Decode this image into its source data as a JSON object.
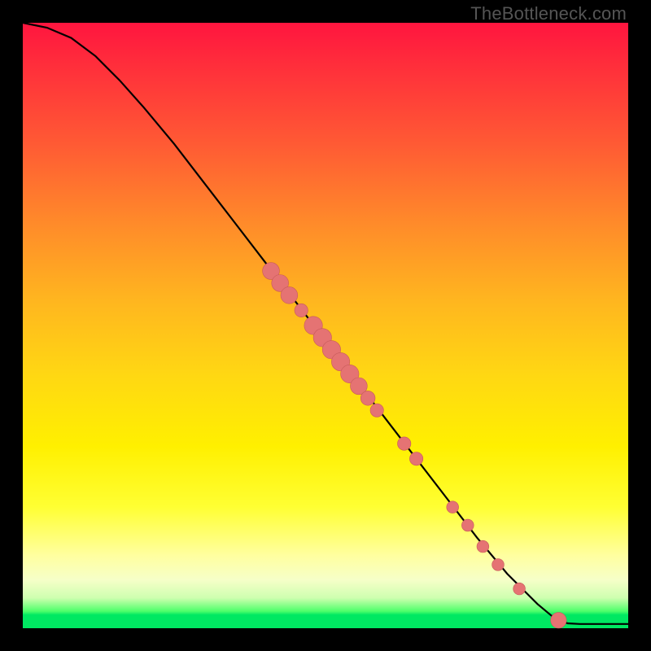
{
  "watermark": "TheBottleneck.com",
  "colors": {
    "bg": "#000000",
    "curve_stroke": "#000000",
    "marker_fill": "#e57373",
    "marker_stroke": "#c75a5a"
  },
  "chart_data": {
    "type": "line",
    "title": "",
    "xlabel": "",
    "ylabel": "",
    "xlim": [
      0,
      100
    ],
    "ylim": [
      0,
      100
    ],
    "grid": false,
    "legend": false,
    "curve": [
      {
        "x": 0,
        "y": 100
      },
      {
        "x": 4,
        "y": 99.2
      },
      {
        "x": 8,
        "y": 97.5
      },
      {
        "x": 12,
        "y": 94.5
      },
      {
        "x": 16,
        "y": 90.5
      },
      {
        "x": 20,
        "y": 86
      },
      {
        "x": 25,
        "y": 80
      },
      {
        "x": 30,
        "y": 73.5
      },
      {
        "x": 35,
        "y": 67
      },
      {
        "x": 40,
        "y": 60.5
      },
      {
        "x": 45,
        "y": 54
      },
      {
        "x": 50,
        "y": 47.5
      },
      {
        "x": 55,
        "y": 41
      },
      {
        "x": 60,
        "y": 34.5
      },
      {
        "x": 65,
        "y": 28
      },
      {
        "x": 70,
        "y": 21.5
      },
      {
        "x": 75,
        "y": 15
      },
      {
        "x": 80,
        "y": 9
      },
      {
        "x": 85,
        "y": 4
      },
      {
        "x": 88,
        "y": 1.5
      },
      {
        "x": 90,
        "y": 0.8
      },
      {
        "x": 92,
        "y": 0.7
      },
      {
        "x": 100,
        "y": 0.7
      }
    ],
    "markers": [
      {
        "x": 41,
        "y": 59,
        "r": 1.4
      },
      {
        "x": 42.5,
        "y": 57,
        "r": 1.4
      },
      {
        "x": 44,
        "y": 55,
        "r": 1.4
      },
      {
        "x": 46,
        "y": 52.5,
        "r": 1.1
      },
      {
        "x": 48,
        "y": 50,
        "r": 1.5
      },
      {
        "x": 49.5,
        "y": 48,
        "r": 1.5
      },
      {
        "x": 51,
        "y": 46,
        "r": 1.5
      },
      {
        "x": 52.5,
        "y": 44,
        "r": 1.5
      },
      {
        "x": 54,
        "y": 42,
        "r": 1.5
      },
      {
        "x": 55.5,
        "y": 40,
        "r": 1.4
      },
      {
        "x": 57,
        "y": 38,
        "r": 1.2
      },
      {
        "x": 58.5,
        "y": 36,
        "r": 1.1
      },
      {
        "x": 63,
        "y": 30.5,
        "r": 1.1
      },
      {
        "x": 65,
        "y": 28,
        "r": 1.1
      },
      {
        "x": 71,
        "y": 20,
        "r": 1.0
      },
      {
        "x": 73.5,
        "y": 17,
        "r": 1.0
      },
      {
        "x": 76,
        "y": 13.5,
        "r": 1.0
      },
      {
        "x": 78.5,
        "y": 10.5,
        "r": 1.0
      },
      {
        "x": 82,
        "y": 6.5,
        "r": 1.0
      },
      {
        "x": 88.5,
        "y": 1.3,
        "r": 1.3
      }
    ]
  }
}
